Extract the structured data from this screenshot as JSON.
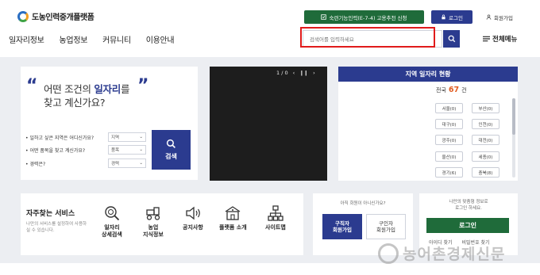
{
  "header": {
    "logo_text": "도농인력중개플랫폼",
    "apply_button": "숙련기능인력(E-7-4) 고용추천 신청",
    "login_button": "로그인",
    "signup_button": "회원가입"
  },
  "nav": {
    "items": [
      "일자리정보",
      "농업정보",
      "커뮤니티",
      "이용안내"
    ],
    "menu_all": "전체메뉴"
  },
  "search": {
    "placeholder": "검색어를 입력하세요"
  },
  "job_search": {
    "headline_pre": "어떤 조건의 ",
    "headline_hl": "일자리",
    "headline_post": "를",
    "headline_line2": "찾고 계신가요?",
    "questions": [
      {
        "label": "일하고 싶은 지역은 어디신가요?",
        "value": "지역"
      },
      {
        "label": "어떤 품목을 찾고 계신가요?",
        "value": "품목"
      },
      {
        "label": "경력은?",
        "value": "경력"
      }
    ],
    "search_button": "검색"
  },
  "video": {
    "counter": "1 / 0"
  },
  "region": {
    "title": "지역 일자리 현황",
    "total_label": "전국",
    "total_value": "67",
    "total_unit": "건",
    "cells": [
      "서울(0)",
      "부산(0)",
      "대구(0)",
      "인천(0)",
      "광주(0)",
      "대전(0)",
      "울산(0)",
      "세종(0)",
      "경기(6)",
      "충북(8)"
    ]
  },
  "services": {
    "title": "자주찾는 서비스",
    "desc": "나만의 서비스를 설정하여 사용하실 수 있습니다.",
    "items": [
      {
        "label_1": "일자리",
        "label_2": "상세검색",
        "icon": "search-doc-icon"
      },
      {
        "label_1": "농업",
        "label_2": "지식정보",
        "icon": "tractor-icon"
      },
      {
        "label_1": "공지사항",
        "label_2": "",
        "icon": "speaker-icon"
      },
      {
        "label_1": "플랫폼 소개",
        "label_2": "",
        "icon": "building-icon"
      },
      {
        "label_1": "사이트맵",
        "label_2": "",
        "icon": "sitemap-icon"
      }
    ]
  },
  "member": {
    "question": "아직 회원이 아니신가요?",
    "seeker_1": "구직자",
    "seeker_2": "회원가입",
    "company_1": "구인자",
    "company_2": "회원가입"
  },
  "login_card": {
    "msg_1": "나만의 맞춤형 정보로",
    "msg_2": "로그인 하세요.",
    "login_button": "로그인",
    "find_id": "아이디 찾기",
    "find_pw": "비밀번호 찾기"
  },
  "watermark": {
    "text": "농어촌경제신문"
  },
  "colors": {
    "primary": "#2b3b8f",
    "green": "#1f6b3a",
    "accent": "#e15b1f",
    "highlight": "#e01b1b"
  }
}
